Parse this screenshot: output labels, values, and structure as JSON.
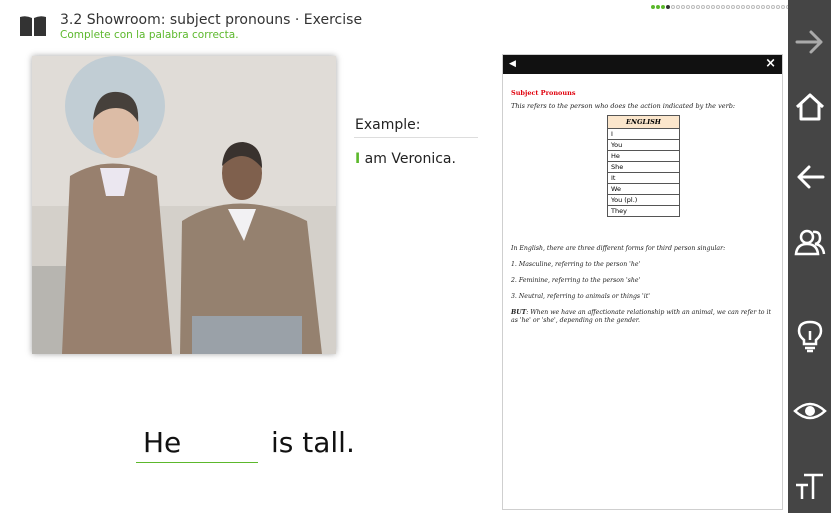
{
  "header": {
    "title": "3.2 Showroom: subject pronouns · Exercise",
    "subtitle": "Complete con la palabra correcta."
  },
  "progress": {
    "total": 34,
    "completed": 3,
    "current_index": 3,
    "done_color": "#5cb82c"
  },
  "example": {
    "label": "Example:",
    "highlight": "I",
    "sentence_rest": " am Veronica."
  },
  "exercise": {
    "answer": "He",
    "sentence_rest": "is tall."
  },
  "panel": {
    "heading": "Subject Pronouns",
    "intro": "This refers to the person who does the action indicated by the verb:",
    "table_header": "ENGLISH",
    "pronouns": [
      "I",
      "You",
      "He",
      "She",
      "It",
      "We",
      "You (pl.)",
      "They"
    ],
    "text1": "In English, there are three different forms for third person singular:",
    "text2": "1. Masculine, referring to the person 'he'",
    "text3": "2. Feminine, referring to the person 'she'",
    "text4": "3. Neutral, referring to animals or things 'it'",
    "text5_bold": "BUT",
    "text5": ": When we have an affectionate relationship with an animal, we can refer to it as 'he' or 'she', depending on the gender."
  },
  "sidebar": {
    "icons": [
      "arrow-right-icon",
      "home-icon",
      "arrow-left-icon",
      "users-icon",
      "lightbulb-icon",
      "eye-icon",
      "text-size-icon"
    ]
  }
}
